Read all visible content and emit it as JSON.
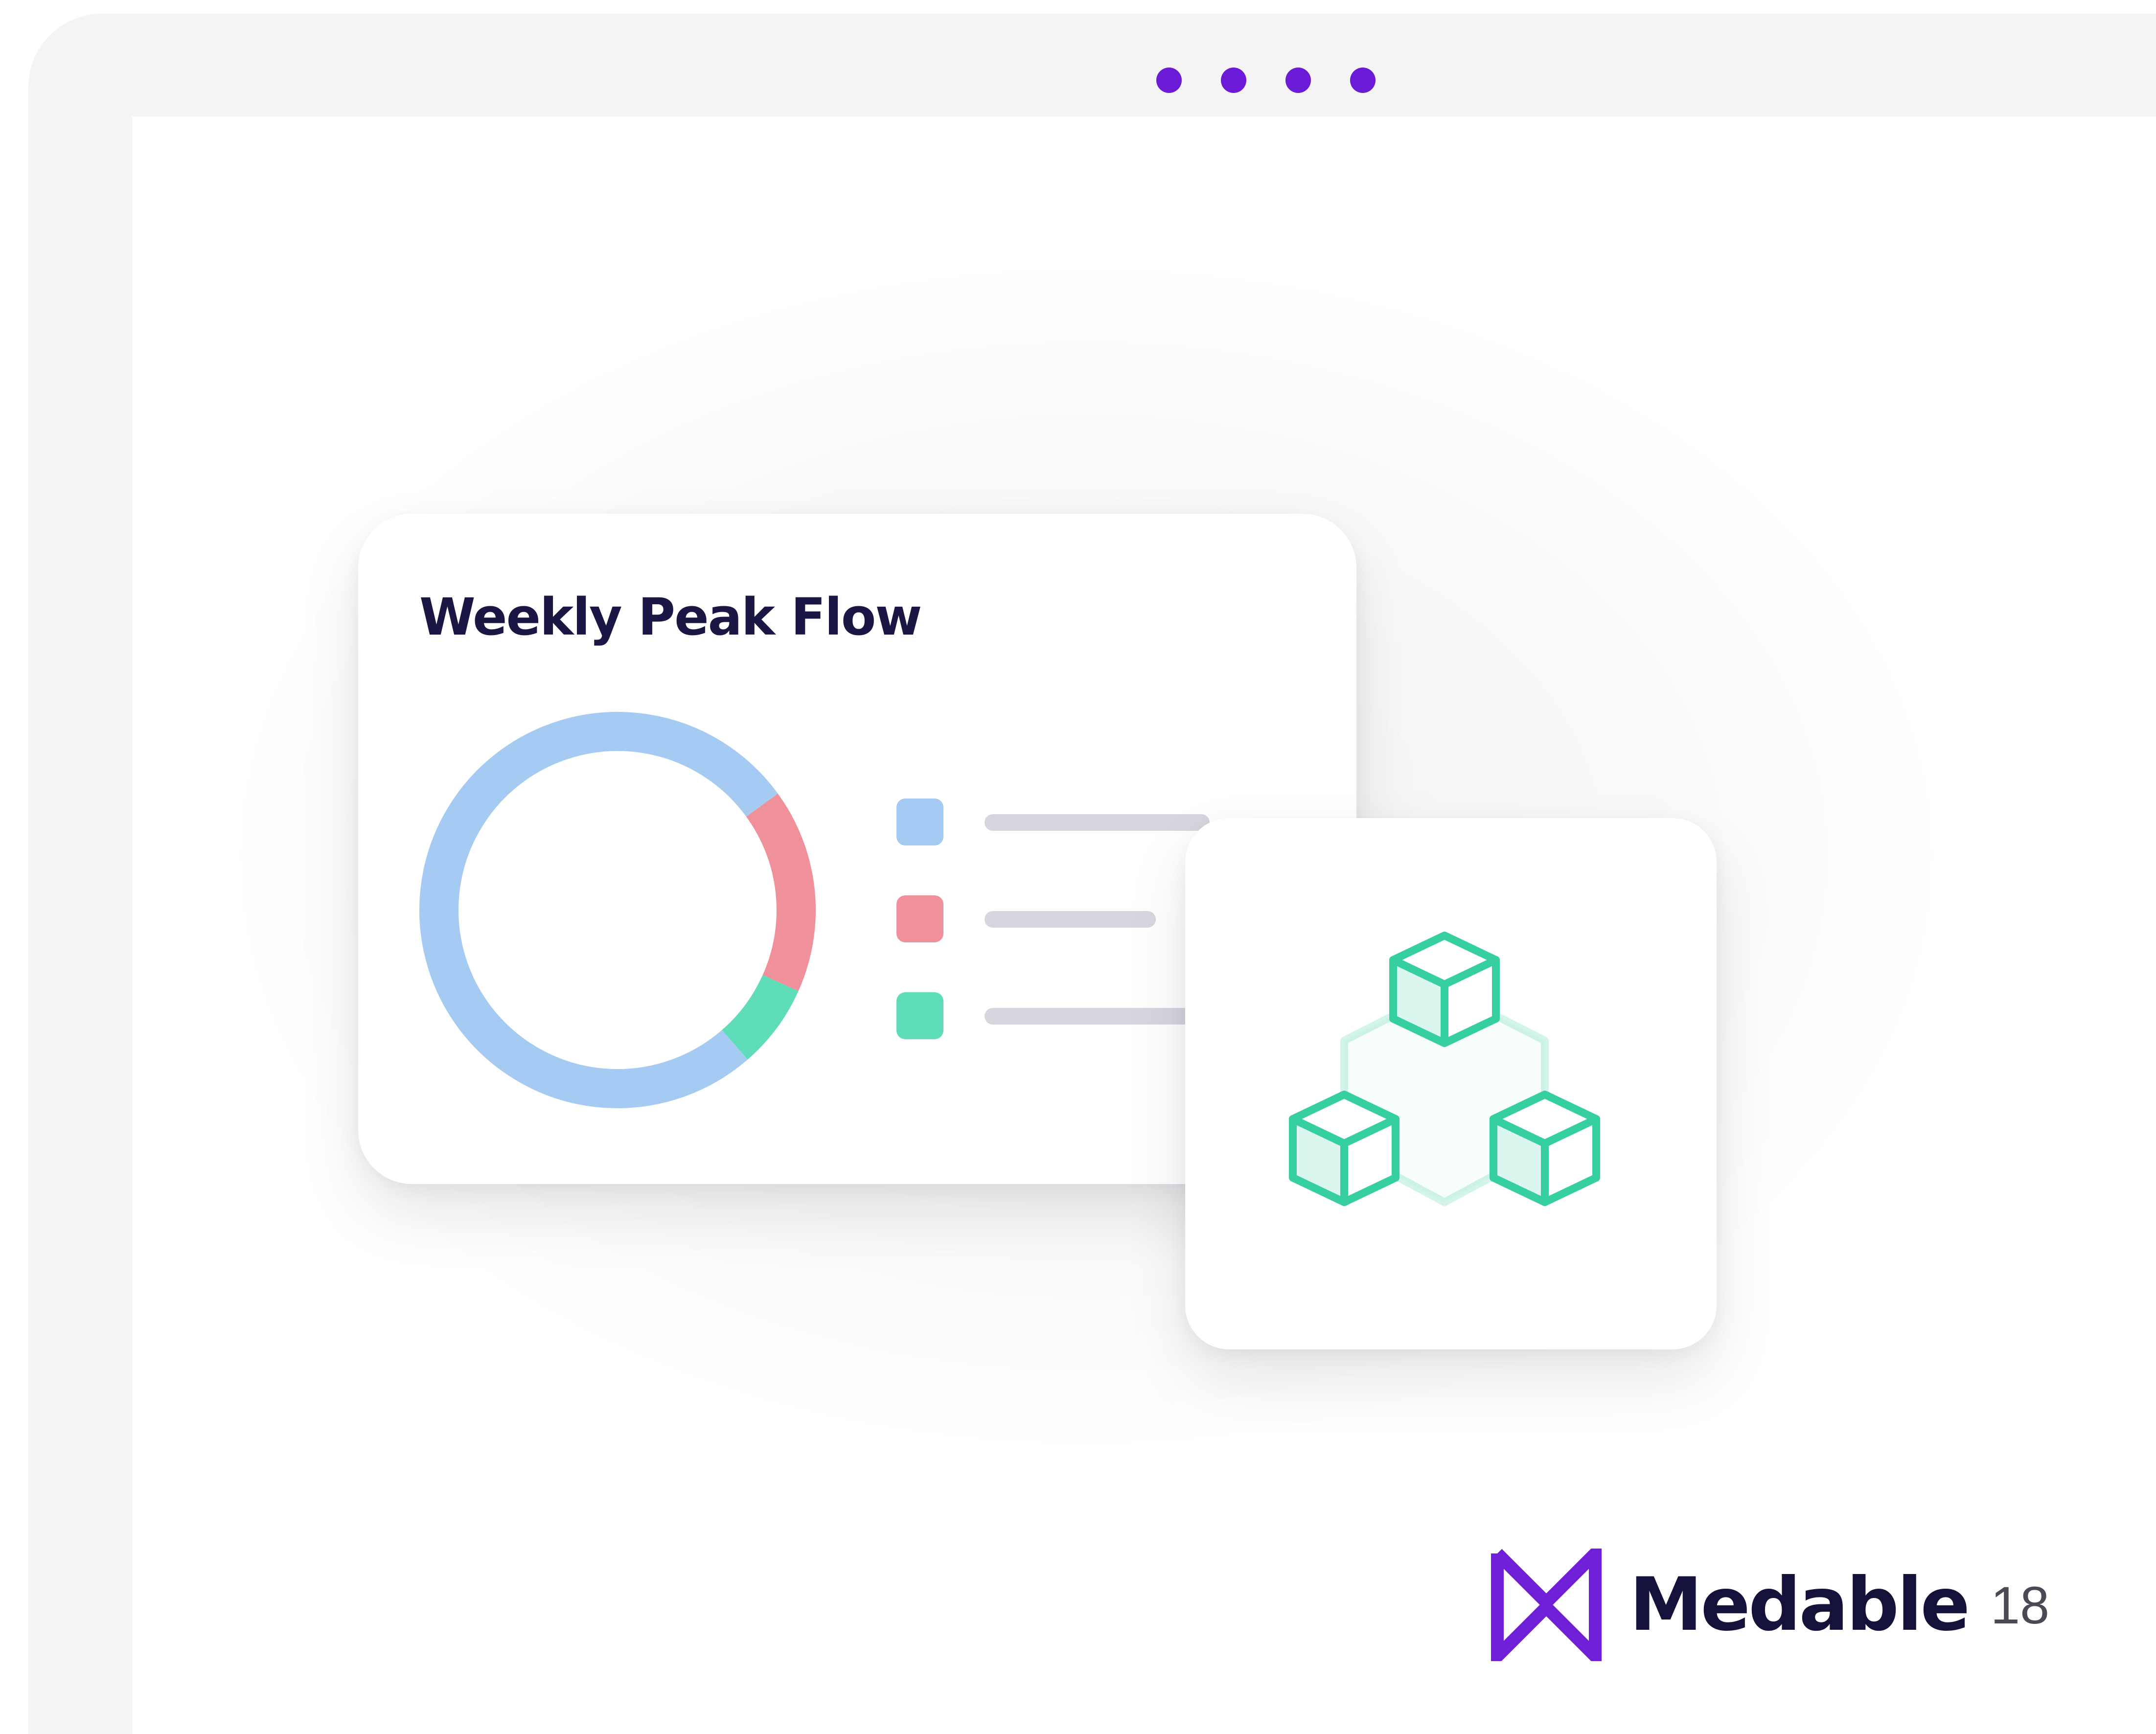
{
  "window": {
    "dots": [
      "#6b1ad6",
      "#6b1ad6",
      "#6b1ad6",
      "#6b1ad6"
    ]
  },
  "chart_card": {
    "title": "Weekly Peak Flow",
    "icon": "donut-chart"
  },
  "chart_data": {
    "type": "pie",
    "title": "Weekly Peak Flow",
    "slices": [
      {
        "color": "#a6cbf2",
        "value": 0.764
      },
      {
        "color": "#f0909a",
        "value": 0.167
      },
      {
        "color": "#5fdcb8",
        "value": 0.069
      }
    ],
    "legend": [
      {
        "color": "#a6cbf2"
      },
      {
        "color": "#f0909a"
      },
      {
        "color": "#5fdcb8"
      }
    ]
  },
  "icon_card": {
    "icon": "blocks-network-icon",
    "color": "#36cf9f"
  },
  "brand": {
    "name": "Medable",
    "logo_color": "#6f1fd8"
  },
  "page": {
    "number": "18"
  }
}
